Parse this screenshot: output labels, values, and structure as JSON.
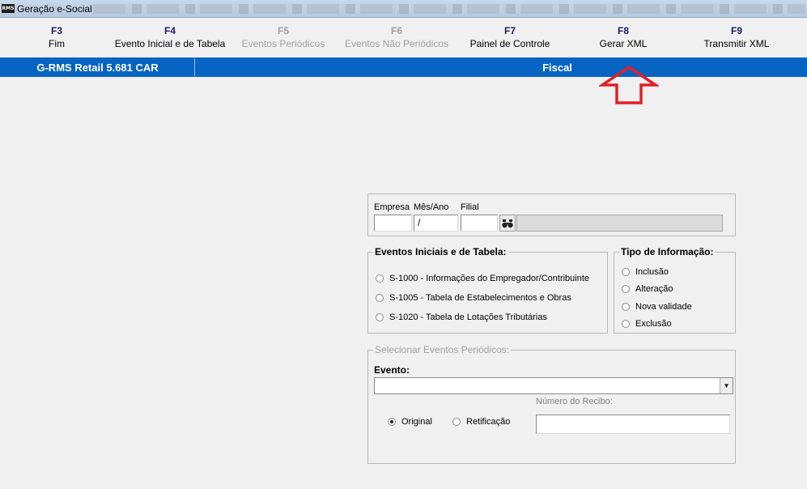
{
  "window": {
    "icon_text": "RMS",
    "title": "Geração e-Social"
  },
  "fkeys": [
    {
      "key": "F3",
      "label": "Fim",
      "enabled": true
    },
    {
      "key": "F4",
      "label": "Evento Inicial e de Tabela",
      "enabled": true
    },
    {
      "key": "F5",
      "label": "Eventos Periódicos",
      "enabled": false
    },
    {
      "key": "F6",
      "label": "Eventos Não Periódicos",
      "enabled": false
    },
    {
      "key": "F7",
      "label": "Painel de Controle",
      "enabled": true
    },
    {
      "key": "F8",
      "label": "Gerar XML",
      "enabled": true
    },
    {
      "key": "F9",
      "label": "Transmitir XML",
      "enabled": true
    }
  ],
  "statusbar": {
    "product": "G-RMS Retail 5.681 CAR",
    "module": "Fiscal"
  },
  "filters": {
    "empresa_label": "Empresa",
    "mes_ano_label": "Mês/Ano",
    "filial_label": "Filial",
    "empresa_value": "",
    "mes_ano_value": " /",
    "filial_value": "",
    "description_value": ""
  },
  "eventos_iniciais": {
    "title": "Eventos Iniciais e de Tabela:",
    "options": [
      {
        "label": "S-1000 - Informações do Empregador/Contribuinte",
        "selected": false
      },
      {
        "label": "S-1005 - Tabela de Estabelecimentos e Obras",
        "selected": false
      },
      {
        "label": "S-1020 - Tabela de Lotações Tributárias",
        "selected": false
      }
    ]
  },
  "tipo_informacao": {
    "title": "Tipo de Informação:",
    "options": [
      {
        "label": "Inclusão",
        "selected": false
      },
      {
        "label": "Alteração",
        "selected": false
      },
      {
        "label": "Nova validade",
        "selected": false
      },
      {
        "label": "Exclusão",
        "selected": false
      }
    ]
  },
  "periodicos": {
    "title": "Selecionar Eventos Periódicos:",
    "evento_label": "Evento:",
    "evento_value": "",
    "recibo_label": "Número do Recibo:",
    "recibo_value": "",
    "options": [
      {
        "label": "Original",
        "selected": true
      },
      {
        "label": "Retificação",
        "selected": false
      }
    ]
  },
  "colors": {
    "statusbar": "#0864c2",
    "arrow": "#e01f26",
    "disabled_text": "#a0a0a0"
  },
  "icons": {
    "app": "app-icon",
    "find": "binoculars-icon",
    "dropdown": "chevron-down-icon",
    "annotation": "up-arrow-annotation"
  }
}
